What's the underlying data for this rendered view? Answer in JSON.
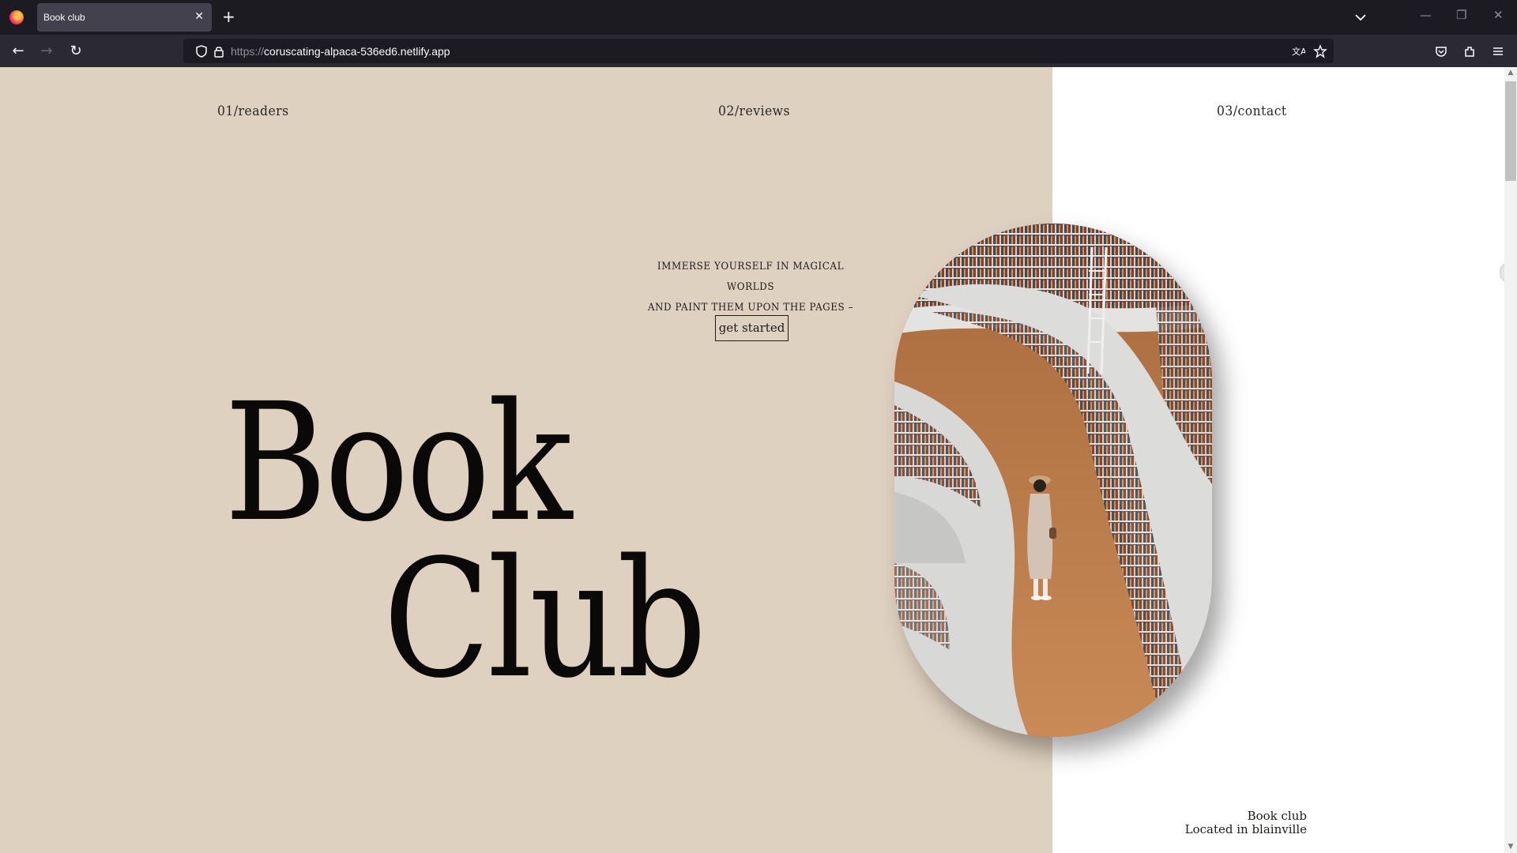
{
  "browser": {
    "tab_title": "Book club",
    "tab_close": "✕",
    "new_tab": "+",
    "url_protocol": "https://",
    "url_host": "coruscating-alpaca-536ed6.netlify.app"
  },
  "nav": {
    "readers": "01/readers",
    "reviews": "02/reviews",
    "contact": "03/contact"
  },
  "hero": {
    "tagline_line1": "Immerse yourself in magical worlds",
    "tagline_line2": "and paint them upon the pages –",
    "cta_label": "get started",
    "title_line1": "Book",
    "title_line2": "Club"
  },
  "footer": {
    "line1": "Book club",
    "line2": "Located in blainville"
  },
  "colors": {
    "beige": "#dfd1c0",
    "ink": "#0a0908"
  }
}
